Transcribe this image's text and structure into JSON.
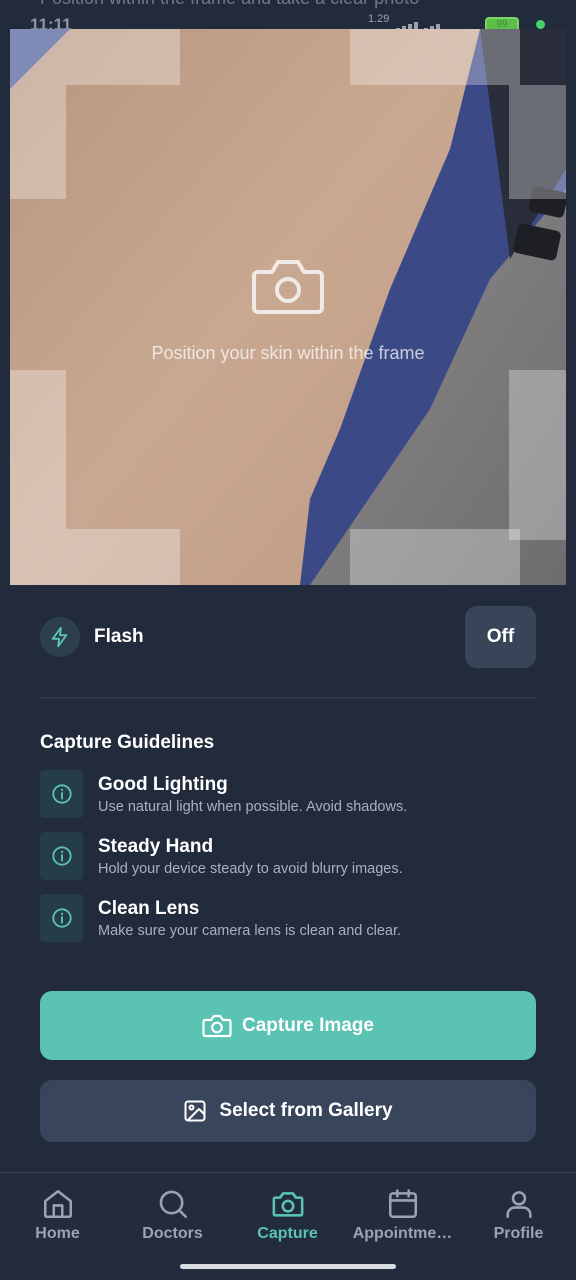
{
  "status_bar": {
    "time": "11:11",
    "net_speed": "1.29",
    "battery": "99",
    "overlapped_header": "Position within the frame and take a clear photo"
  },
  "preview": {
    "hint": "Position your skin within the frame",
    "icon": "camera-icon"
  },
  "flash": {
    "label": "Flash",
    "state": "Off",
    "icon": "lightning-icon"
  },
  "guidelines": {
    "title": "Capture Guidelines",
    "items": [
      {
        "title": "Good Lighting",
        "desc": "Use natural light when possible. Avoid shadows.",
        "icon": "info-icon"
      },
      {
        "title": "Steady Hand",
        "desc": "Hold your device steady to avoid blurry images.",
        "icon": "info-icon"
      },
      {
        "title": "Clean Lens",
        "desc": "Make sure your camera lens is clean and clear.",
        "icon": "info-icon"
      }
    ]
  },
  "actions": {
    "capture": "Capture Image",
    "gallery": "Select from Gallery"
  },
  "nav": {
    "active": "Capture",
    "items": [
      {
        "label": "Home",
        "icon": "home-icon"
      },
      {
        "label": "Doctors",
        "icon": "search-icon"
      },
      {
        "label": "Capture",
        "icon": "camera-icon"
      },
      {
        "label": "Appointme…",
        "icon": "calendar-icon"
      },
      {
        "label": "Profile",
        "icon": "user-icon"
      }
    ]
  },
  "colors": {
    "background": "#222b3c",
    "accent": "#5bc3b3",
    "secondary_button": "#39455a"
  }
}
